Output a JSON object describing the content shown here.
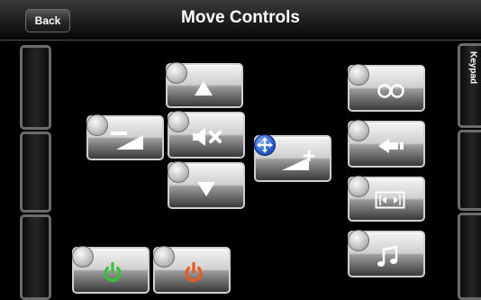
{
  "header": {
    "back_label": "Back",
    "title": "Move Controls"
  },
  "right_panel": {
    "keypad_label": "Keypad"
  },
  "controls": [
    {
      "name": "channel-up-button",
      "icon": "triangle-up-icon"
    },
    {
      "name": "volume-button",
      "icon": "volume-ramp-icon"
    },
    {
      "name": "mute-button",
      "icon": "mute-icon"
    },
    {
      "name": "channel-down-button",
      "icon": "triangle-down-icon"
    },
    {
      "name": "volume-up-button",
      "icon": "volume-plus-icon",
      "selected": true
    },
    {
      "name": "infinity-button",
      "icon": "infinity-icon"
    },
    {
      "name": "back-arrow-button",
      "icon": "arrow-left-icon"
    },
    {
      "name": "aspect-button",
      "icon": "aspect-ratio-icon"
    },
    {
      "name": "music-button",
      "icon": "music-note-icon"
    },
    {
      "name": "power-on-button",
      "icon": "power-icon",
      "color": "#34c534"
    },
    {
      "name": "power-off-button",
      "icon": "power-icon",
      "color": "#ee5a1c"
    }
  ]
}
